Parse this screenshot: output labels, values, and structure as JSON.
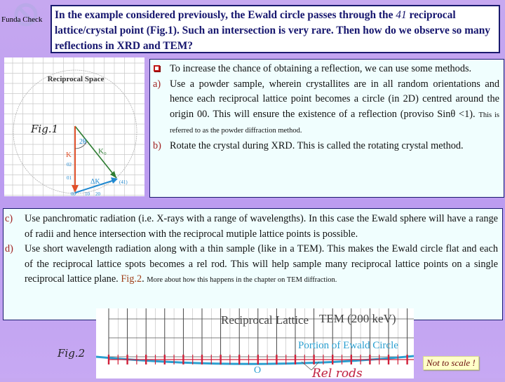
{
  "corner": {
    "label": "Funda Check",
    "icon": "no-symbol-icon"
  },
  "question": {
    "text_before": "In the example considered previously, the Ewald circle passes through the ",
    "highlight": "41",
    "text_after": " reciprocal lattice/crystal point (Fig.1). Such an intersection is very rare. Then how do we observe so many reflections in XRD and TEM?"
  },
  "fig1": {
    "caption": "Fig.1",
    "title": "Reciprocal Space",
    "labels": {
      "angle": "2θ",
      "k0": "K₀",
      "kd": "K",
      "delta_k": "ΔK",
      "point_41": "(41)",
      "origin": "00",
      "y1": "01",
      "y2": "02",
      "x1": "10",
      "x2": "20"
    },
    "colors": {
      "k0": "#2e7d32",
      "kd": "#e0502a",
      "delta_k": "#1e88d0"
    }
  },
  "methods": {
    "intro": "To increase the chance of obtaining a reflection, we can use some methods.",
    "a_mark": "a)",
    "a_text": "Use a powder sample, wherein crystallites are in all random orientations and hence each reciprocal lattice point becomes a circle (in 2D) centred around the origin 00. This will ensure the existence of a reflection (proviso Sinθ <1).",
    "a_small": "This is referred to as the powder diffraction method.",
    "b_mark": "b)",
    "b_text": "Rotate the crystal during XRD. This is called the rotating crystal method.",
    "c_mark": "c)",
    "c_text": "Use panchromatic radiation (i.e. X-rays with a range of wavelengths). In this case the Ewald sphere will have a range of radii and hence intersection with the reciprocal mutiple lattice points is possible.",
    "d_mark": "d)",
    "d_text": "Use short wavelength radiation along with a thin sample (like in a TEM). This makes the Ewald circle flat and each of the reciprocal lattice spots becomes a rel rod. This will help sample many reciprocal lattice points on a single reciprocal lattice plane.",
    "d_link": "Fig.2",
    "d_small": "More about how this happens in the chapter on TEM diffraction."
  },
  "fig2": {
    "caption": "Fig.2",
    "title": "Reciprocal Lattice",
    "subtitle": "TEM (200 keV)",
    "ewald_label": "Portion of Ewald Circle",
    "origin_label": "O",
    "rods_label": "Rel rods",
    "colors": {
      "ewald": "#2a9fd0",
      "rods": "#d0203a"
    }
  },
  "note": "Not to scale !"
}
